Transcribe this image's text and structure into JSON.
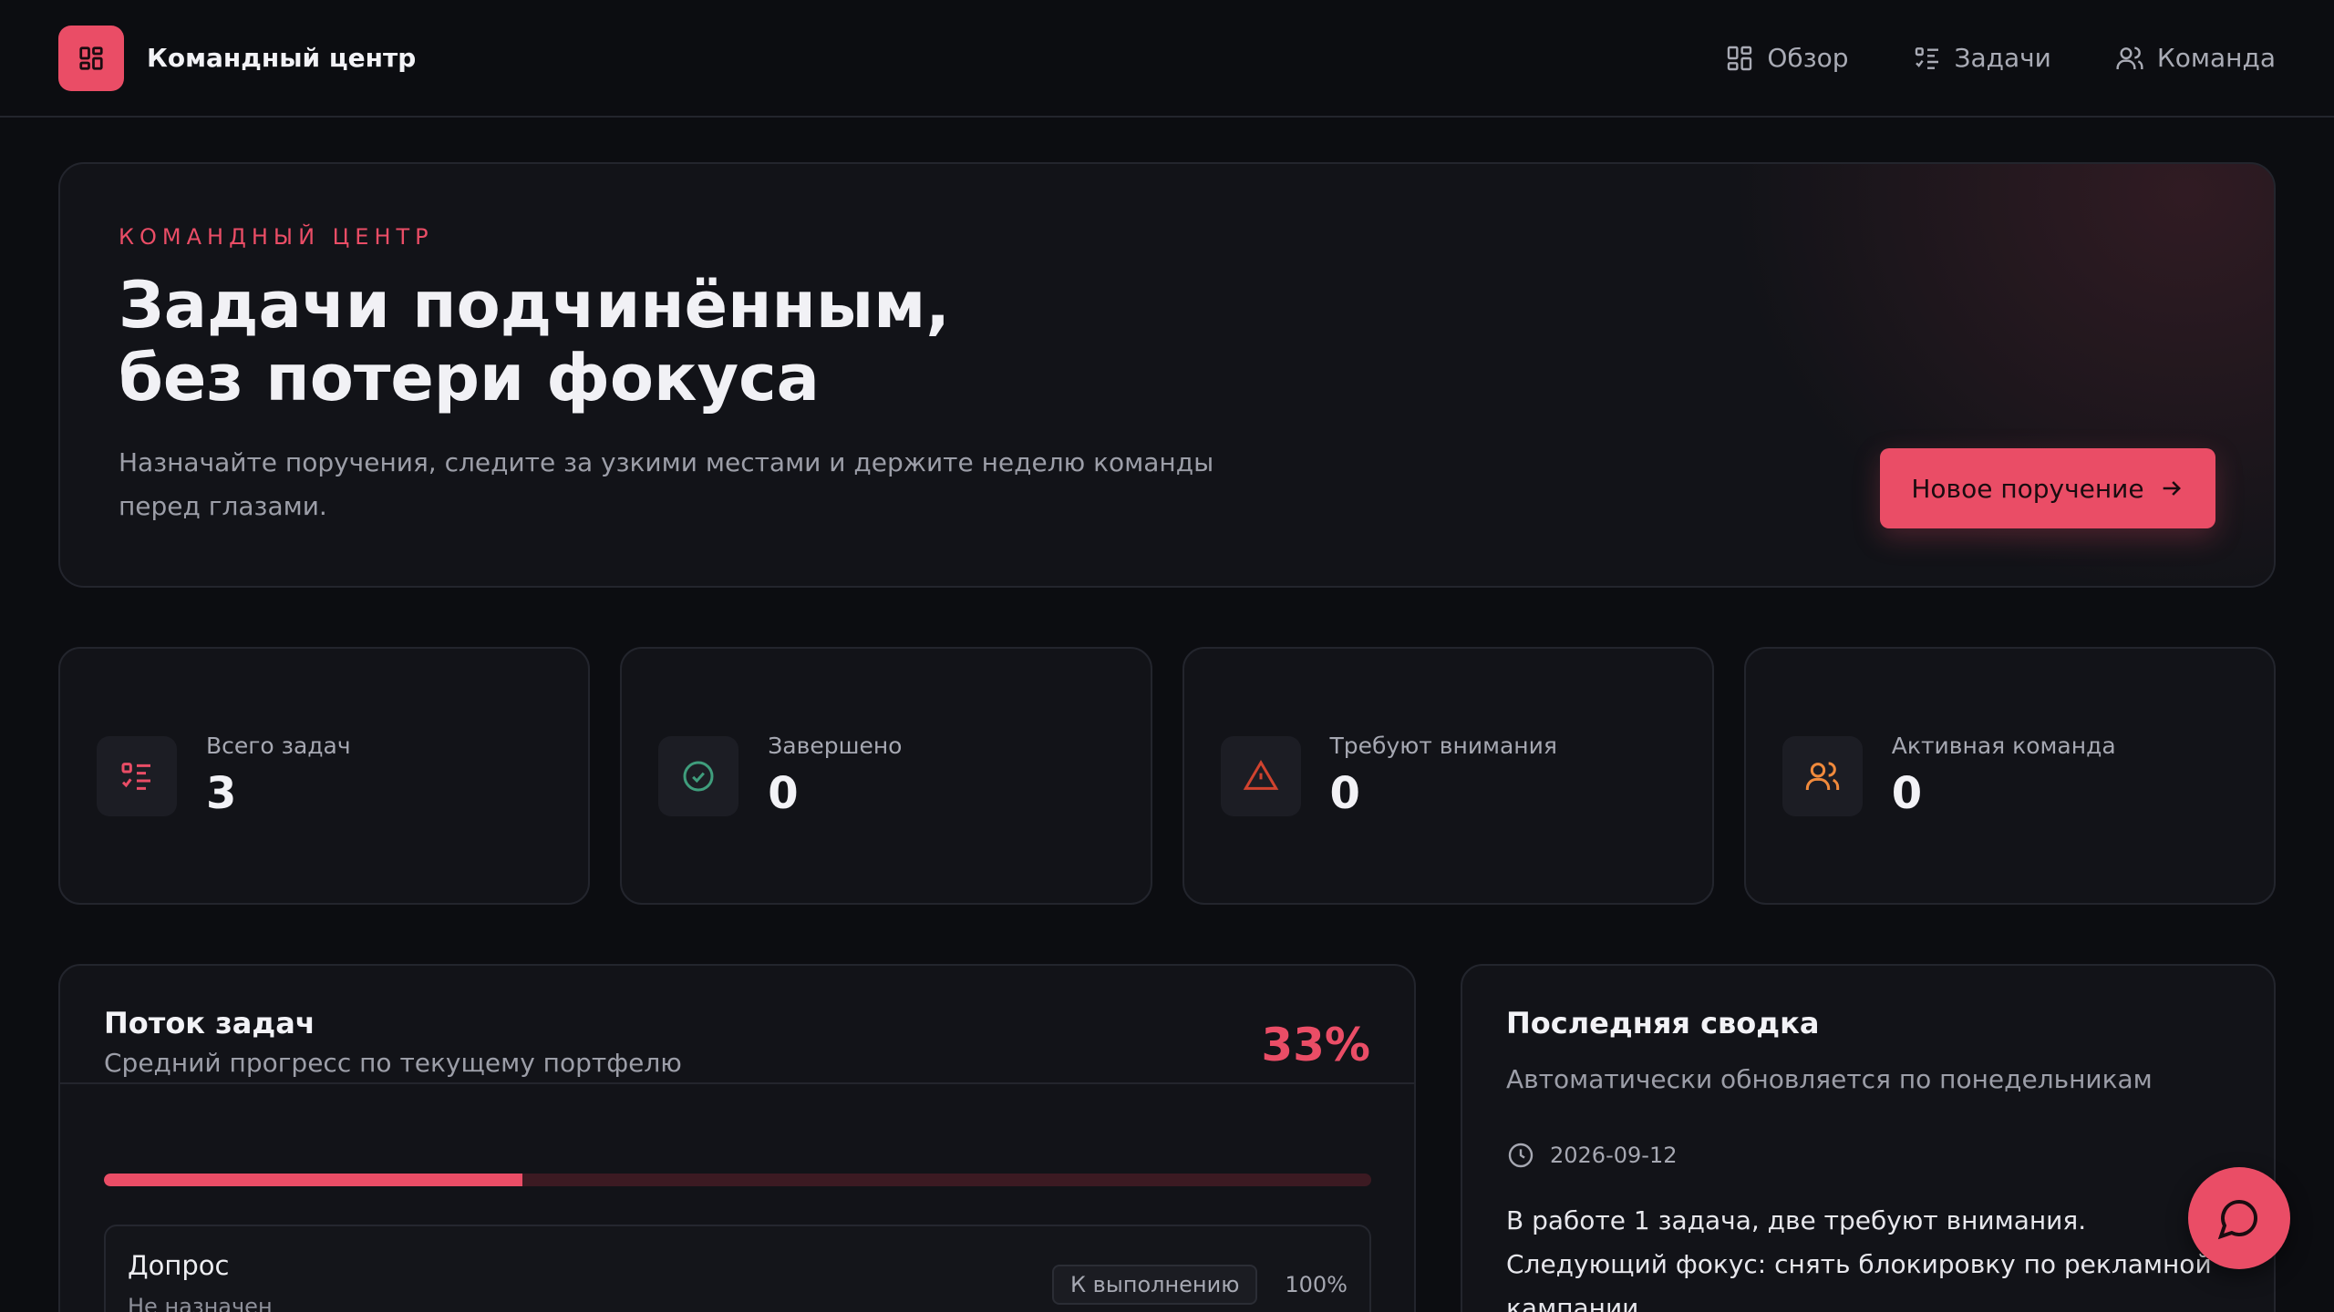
{
  "header": {
    "app_title": "Командный центр",
    "logo_icon": "dashboard-grid-icon",
    "nav": [
      {
        "label": "Обзор",
        "icon": "dashboard-grid-icon"
      },
      {
        "label": "Задачи",
        "icon": "task-list-icon"
      },
      {
        "label": "Команда",
        "icon": "users-icon"
      }
    ]
  },
  "hero": {
    "eyebrow": "КОМАНДНЫЙ ЦЕНТР",
    "title_line1": "Задачи подчинённым,",
    "title_line2": "без потери фокуса",
    "description": "Назначайте поручения, следите за узкими местами и держите неделю команды перед глазами.",
    "cta_label": "Новое поручение",
    "cta_icon": "arrow-right-icon"
  },
  "stats": [
    {
      "label": "Всего задач",
      "value": "3",
      "icon": "task-list-icon",
      "color": "#ea4d66"
    },
    {
      "label": "Завершено",
      "value": "0",
      "icon": "check-circle-icon",
      "color": "#3f9d7c"
    },
    {
      "label": "Требуют внимания",
      "value": "0",
      "icon": "warning-triangle-icon",
      "color": "#d0432f"
    },
    {
      "label": "Активная команда",
      "value": "0",
      "icon": "users-icon",
      "color": "#f08a3c"
    }
  ],
  "flow": {
    "title": "Поток задач",
    "subtitle": "Средний прогресс по текущему портфелю",
    "percent_label": "33%",
    "progress": 0.33,
    "tasks": [
      {
        "title": "Допрос",
        "assignee": "Не назначен",
        "status": "К выполнению",
        "percent": "100%"
      }
    ]
  },
  "summary": {
    "title": "Последняя сводка",
    "subtitle": "Автоматически обновляется по понедельникам",
    "date": "2026-09-12",
    "date_icon": "clock-icon",
    "text": "В работе 1 задача, две требуют внимания. Следующий фокус: снять блокировку по рекламной кампании."
  },
  "chat": {
    "icon": "chat-bubble-icon"
  },
  "colors": {
    "accent": "#ea4d66",
    "background": "#0c0d11",
    "card": "#121318",
    "border": "#23252d"
  }
}
